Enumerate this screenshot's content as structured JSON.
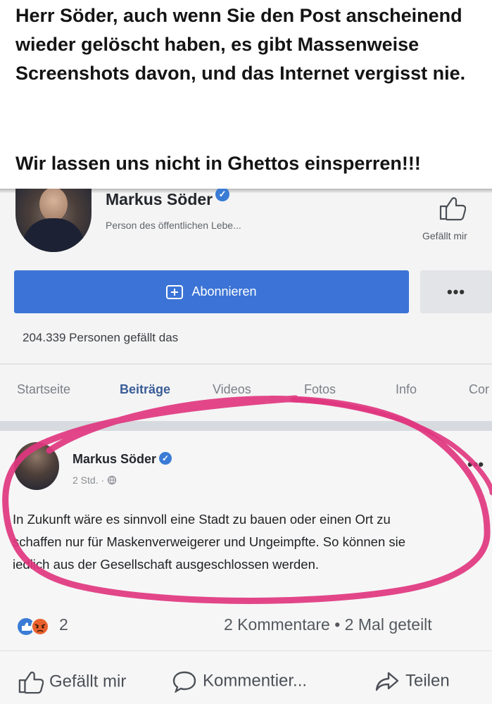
{
  "caption": {
    "paragraph1": "Herr Söder, auch wenn Sie den Post anscheinend wieder gelöscht haben, es gibt Massenweise Screenshots davon, und das Internet vergisst nie.",
    "paragraph2": "Wir lassen uns nicht in Ghettos einsperren!!!"
  },
  "page": {
    "name": "Markus Söder",
    "category": "Person des öffentlichen Lebe...",
    "like_label": "Gefällt mir",
    "subscribe_label": "Abonnieren",
    "more_label": "•••",
    "likes_count": "204.339 Personen gefällt das"
  },
  "tabs": [
    {
      "label": "Startseite",
      "active": false
    },
    {
      "label": "Beiträge",
      "active": true
    },
    {
      "label": "Videos",
      "active": false
    },
    {
      "label": "Fotos",
      "active": false
    },
    {
      "label": "Info",
      "active": false
    },
    {
      "label": "Cor",
      "active": false
    }
  ],
  "post": {
    "author": "Markus Söder",
    "time": "2 Std. · ",
    "menu": "•••",
    "lines": [
      "In Zukunft wäre es sinnvoll eine Stadt zu bauen oder einen Ort zu",
      "schaffen nur für Maskenverweigerer und Ungeimpfte. So können sie",
      "iedlich aus der Gesellschaft  ausgeschlossen werden."
    ],
    "reaction_count": "2",
    "comments_shares": "2 Kommentare • 2 Mal geteilt"
  },
  "actions": {
    "like": "Gefällt mir",
    "comment": "Kommentier...",
    "share": "Teilen"
  },
  "colors": {
    "accent_blue": "#3b74d6",
    "highlight_pink": "#e0367f",
    "verified": "#3a7bd5"
  }
}
